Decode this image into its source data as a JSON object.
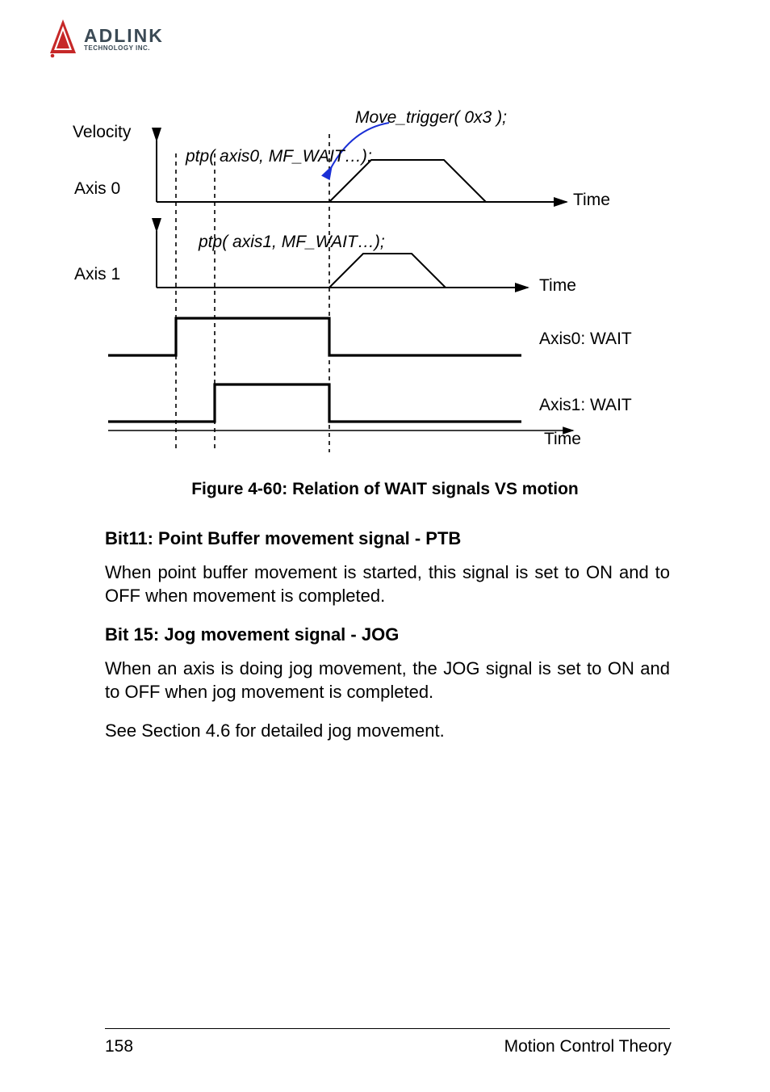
{
  "logo": {
    "main": "ADLINK",
    "sub": "TECHNOLOGY INC."
  },
  "diagram": {
    "velocity": "Velocity",
    "axis0": "Axis 0",
    "axis1": "Axis 1",
    "ptp0": "ptp( axis0, MF_WAIT…);",
    "ptp1": "ptp( axis1, MF_WAIT…);",
    "move_trigger": "Move_trigger( 0x3 );",
    "time": "Time",
    "axis0_wait": "Axis0: WAIT",
    "axis1_wait": "Axis1: WAIT"
  },
  "figure_caption": "Figure 4-60: Relation of WAIT signals VS motion",
  "sections": {
    "bit11_heading": "Bit11: Point Buffer movement signal - PTB",
    "bit11_body": "When point buffer movement is started, this signal is set to ON and to OFF when movement is completed.",
    "bit15_heading": "Bit 15: Jog movement signal - JOG",
    "bit15_body": "When an axis is doing jog movement, the JOG signal is set to ON and to OFF when jog movement is completed.",
    "see_section": "See Section 4.6 for detailed jog movement."
  },
  "footer": {
    "page": "158",
    "title": "Motion Control Theory"
  }
}
